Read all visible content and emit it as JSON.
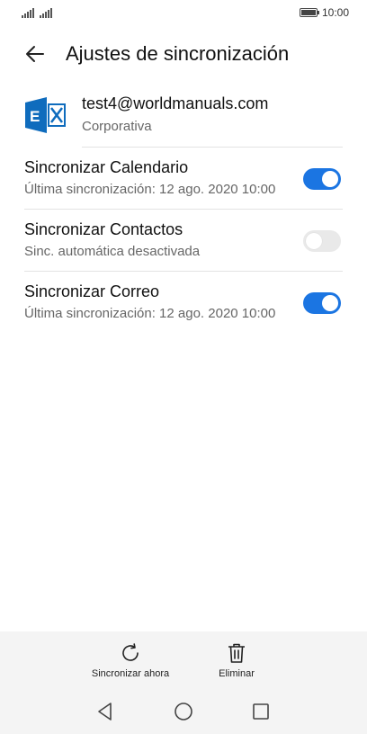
{
  "status_bar": {
    "time": "10:00"
  },
  "header": {
    "title": "Ajustes de sincronización"
  },
  "account": {
    "email": "test4@worldmanuals.com",
    "type": "Corporativa"
  },
  "sync_items": [
    {
      "title": "Sincronizar Calendario",
      "subtitle": "Última sincronización: 12 ago. 2020 10:00",
      "enabled": true
    },
    {
      "title": "Sincronizar Contactos",
      "subtitle": "Sinc. automática desactivada",
      "enabled": false
    },
    {
      "title": "Sincronizar Correo",
      "subtitle": "Última sincronización: 12 ago. 2020 10:00",
      "enabled": true
    }
  ],
  "actions": {
    "sync_now": "Sincronizar ahora",
    "delete": "Eliminar"
  },
  "icons": {
    "back": "arrow-left-icon",
    "account": "exchange-icon",
    "sync_now": "refresh-icon",
    "delete": "trash-icon",
    "nav_back": "triangle-back-icon",
    "nav_home": "circle-home-icon",
    "nav_recents": "square-recents-icon"
  },
  "colors": {
    "accent": "#1b75e2",
    "exchange": "#0f6cbd",
    "toggle_off": "#e9e9e9",
    "bottom_bar": "#f4f4f4"
  }
}
